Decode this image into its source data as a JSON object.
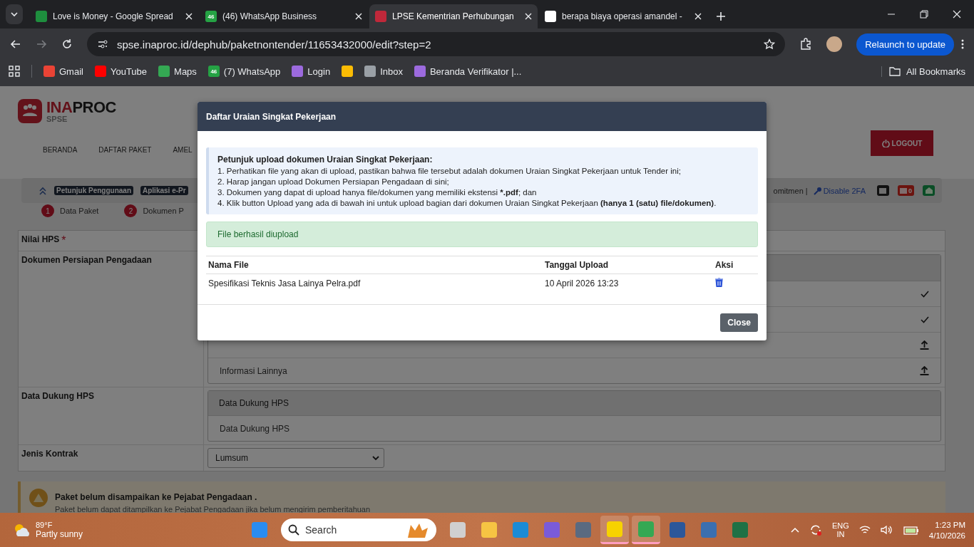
{
  "browser": {
    "tabs": [
      {
        "title": "Love is Money - Google Spread",
        "kind": "sheets",
        "selected": false
      },
      {
        "title": "(46) WhatsApp Business",
        "kind": "whatsapp",
        "badge": "46",
        "selected": false
      },
      {
        "title": "LPSE Kementrian Perhubungan",
        "kind": "lpse",
        "selected": true
      },
      {
        "title": "berapa biaya operasi amandel -",
        "kind": "google",
        "selected": false
      }
    ],
    "url": "spse.inaproc.id/dephub/paketnontender/11653432000/edit?step=2",
    "relaunch": "Relaunch to update",
    "bookmarks": [
      {
        "label": "Gmail",
        "kind": "gmail"
      },
      {
        "label": "YouTube",
        "kind": "youtube"
      },
      {
        "label": "Maps",
        "kind": "maps"
      },
      {
        "label": "(7) WhatsApp",
        "kind": "whatsapp",
        "badge": "46"
      },
      {
        "label": "Login",
        "kind": "globe"
      },
      {
        "kind": "pinwheel"
      },
      {
        "label": "Inbox",
        "kind": "mail"
      },
      {
        "label": "Beranda Verifikator |...",
        "kind": "globe"
      }
    ],
    "all_bookmarks": "All Bookmarks"
  },
  "page": {
    "logo": {
      "name_a": "INA",
      "name_b": "PROC",
      "sub": "SPSE"
    },
    "nav": [
      "BERANDA",
      "DAFTAR PAKET",
      "AMEL"
    ],
    "logout": "LOGOUT",
    "toolbar": {
      "links": [
        "Petunjuk Penggunaan",
        "Aplikasi e-Pr"
      ],
      "right_text": "omitmen |",
      "disable_2fa": "Disable 2FA",
      "inbox_count": "0"
    },
    "steps": [
      {
        "number": "1",
        "label": "Data Paket"
      },
      {
        "number": "2",
        "label": "Dokumen P"
      }
    ],
    "fields": [
      {
        "label": "Nilai HPS",
        "required_mark": "*",
        "kind": "blank"
      },
      {
        "label": "Dokumen Persiapan Pengadaan",
        "kind": "docs",
        "docs": [
          {
            "kind": "done"
          },
          {
            "kind": "done"
          },
          {
            "kind": "upload"
          },
          {
            "label": "Informasi Lainnya",
            "kind": "upload"
          }
        ]
      },
      {
        "label": "Data Dukung HPS",
        "kind": "support",
        "header": "Data Dukung HPS",
        "item": "Data Dukung HPS"
      },
      {
        "label": "Jenis Kontrak",
        "kind": "select",
        "value": "Lumsum"
      }
    ],
    "alert": {
      "title": "Paket belum disampaikan ke Pejabat Pengadaan .",
      "text": "Paket belum dapat ditampilkan ke Pejabat Pengadaan jika belum mengirim pemberitahuan"
    }
  },
  "modal": {
    "title": "Daftar Uraian Singkat Pekerjaan",
    "instructions_title": "Petunjuk upload dokumen Uraian Singkat Pekerjaan:",
    "instructions": [
      {
        "text": "1. Perhatikan file yang akan di upload, pastikan bahwa file tersebut adalah dokumen Uraian Singkat Pekerjaan untuk Tender ini;"
      },
      {
        "text": "2. Harap jangan upload Dokumen Persiapan Pengadaan di sini;"
      },
      {
        "text": "3. Dokumen yang dapat di upload hanya file/dokumen yang memiliki ekstensi ",
        "bold": "*.pdf",
        "after": "; dan"
      },
      {
        "text": "4. Klik button Upload yang ada di bawah ini untuk upload bagian dari dokumen Uraian Singkat Pekerjaan ",
        "bold": "(hanya 1 (satu) file/dokumen)",
        "after": "."
      }
    ],
    "success": "File berhasil diupload",
    "columns": [
      "Nama File",
      "Tanggal Upload",
      "Aksi"
    ],
    "rows": [
      {
        "name": "Spesifikasi Teknis Jasa Lainya Pelra.pdf",
        "date": "10 April 2026 13:23"
      }
    ],
    "close": "Close"
  },
  "taskbar": {
    "temp": "89°F",
    "weather": "Partly sunny",
    "search": "Search",
    "apps": [
      {
        "kind": "start",
        "active": false
      },
      {
        "kind": "taskview",
        "active": false
      },
      {
        "kind": "files",
        "active": false
      },
      {
        "kind": "edge",
        "active": false
      },
      {
        "kind": "copilot",
        "active": false
      },
      {
        "kind": "camera",
        "active": false
      },
      {
        "kind": "notes",
        "active": true
      },
      {
        "kind": "chrome",
        "active": true
      },
      {
        "kind": "word",
        "active": false
      },
      {
        "kind": "calculator",
        "active": false
      },
      {
        "kind": "excel",
        "active": false
      }
    ],
    "lang": "ENG",
    "region": "IN",
    "time": "1:23 PM",
    "date": "4/10/2026"
  }
}
